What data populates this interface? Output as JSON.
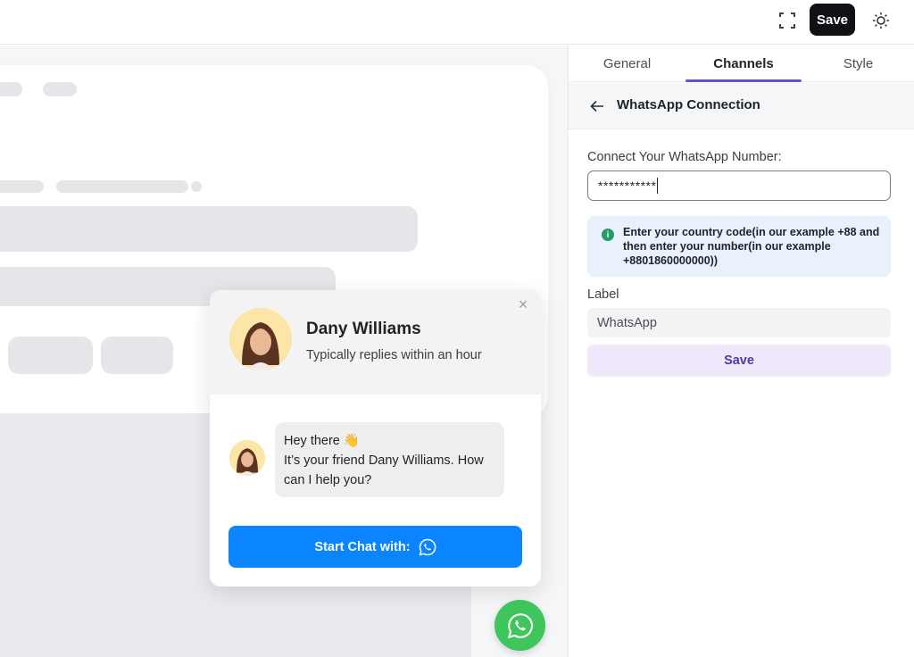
{
  "topbar": {
    "expand_icon": "expand-icon",
    "save_label": "Save",
    "theme_icon": "sun-icon"
  },
  "tabs": [
    {
      "label": "General",
      "active": false
    },
    {
      "label": "Channels",
      "active": true
    },
    {
      "label": "Style",
      "active": false
    }
  ],
  "panel": {
    "back_icon": "arrow-left-icon",
    "title": "WhatsApp Connection",
    "number_label": "Connect Your WhatsApp Number:",
    "number_value": "***********",
    "info_icon": "info-icon",
    "info_text": "Enter your country code(in our example +88 and then enter your number(in our example +8801860000000))",
    "label_heading": "Label",
    "label_value": "WhatsApp",
    "save_label": "Save",
    "accent_color": "#6a4fd6"
  },
  "chat_widget": {
    "agent_name": "Dany Williams",
    "agent_status": "Typically replies within an hour",
    "message_line1": "Hey there 👋",
    "message_line2": "It’s your friend Dany Williams. How can I help you?",
    "start_chat_label": "Start Chat with:",
    "start_chat_icon": "whatsapp-icon",
    "button_color": "#0a84ff",
    "fab_color": "#3ec55b"
  }
}
